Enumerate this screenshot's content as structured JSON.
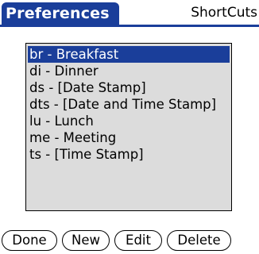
{
  "header": {
    "title": "Preferences",
    "category": "ShortCuts"
  },
  "shortcuts": {
    "items": [
      "br - Breakfast",
      "di - Dinner",
      "ds - [Date Stamp]",
      "dts - [Date and Time Stamp]",
      "lu - Lunch",
      "me - Meeting",
      "ts - [Time Stamp]"
    ],
    "selected": "br - Breakfast"
  },
  "buttons": {
    "done": "Done",
    "new": "New",
    "edit": "Edit",
    "delete": "Delete"
  },
  "colors": {
    "accent": "#1a3e9a",
    "list_background": "#dcdcdc"
  }
}
